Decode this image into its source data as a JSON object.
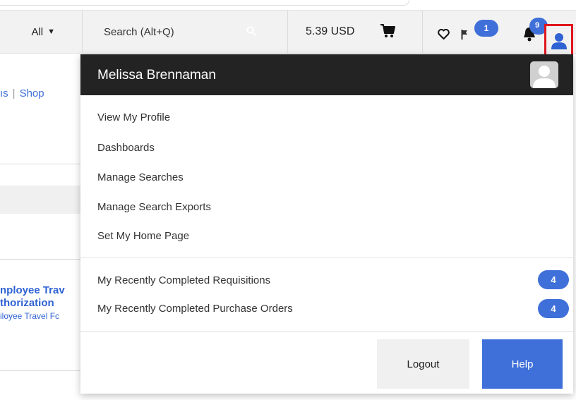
{
  "header": {
    "filter_label": "All",
    "search_placeholder": "Search (Alt+Q)",
    "cart_total": "5.39 USD",
    "action_items_count": "1",
    "notifications_count": "9"
  },
  "background": {
    "breadcrumb_partial": "ıs",
    "breadcrumb_shop": "Shop",
    "link_line1": "nployee Trav",
    "link_line2": "thorization",
    "link_sub": "iloyee Travel Fc"
  },
  "user_menu": {
    "user_name": "Melissa Brennaman",
    "items": [
      {
        "label": "View My Profile"
      },
      {
        "label": "Dashboards"
      },
      {
        "label": "Manage Searches"
      },
      {
        "label": "Manage Search Exports"
      },
      {
        "label": "Set My Home Page"
      }
    ],
    "recent": [
      {
        "label": "My Recently Completed Requisitions",
        "count": "4"
      },
      {
        "label": "My Recently Completed Purchase Orders",
        "count": "4"
      }
    ],
    "logout_label": "Logout",
    "help_label": "Help"
  },
  "colors": {
    "accent": "#3f6fd9",
    "header_dark": "#232323",
    "highlight": "#e0161d"
  }
}
